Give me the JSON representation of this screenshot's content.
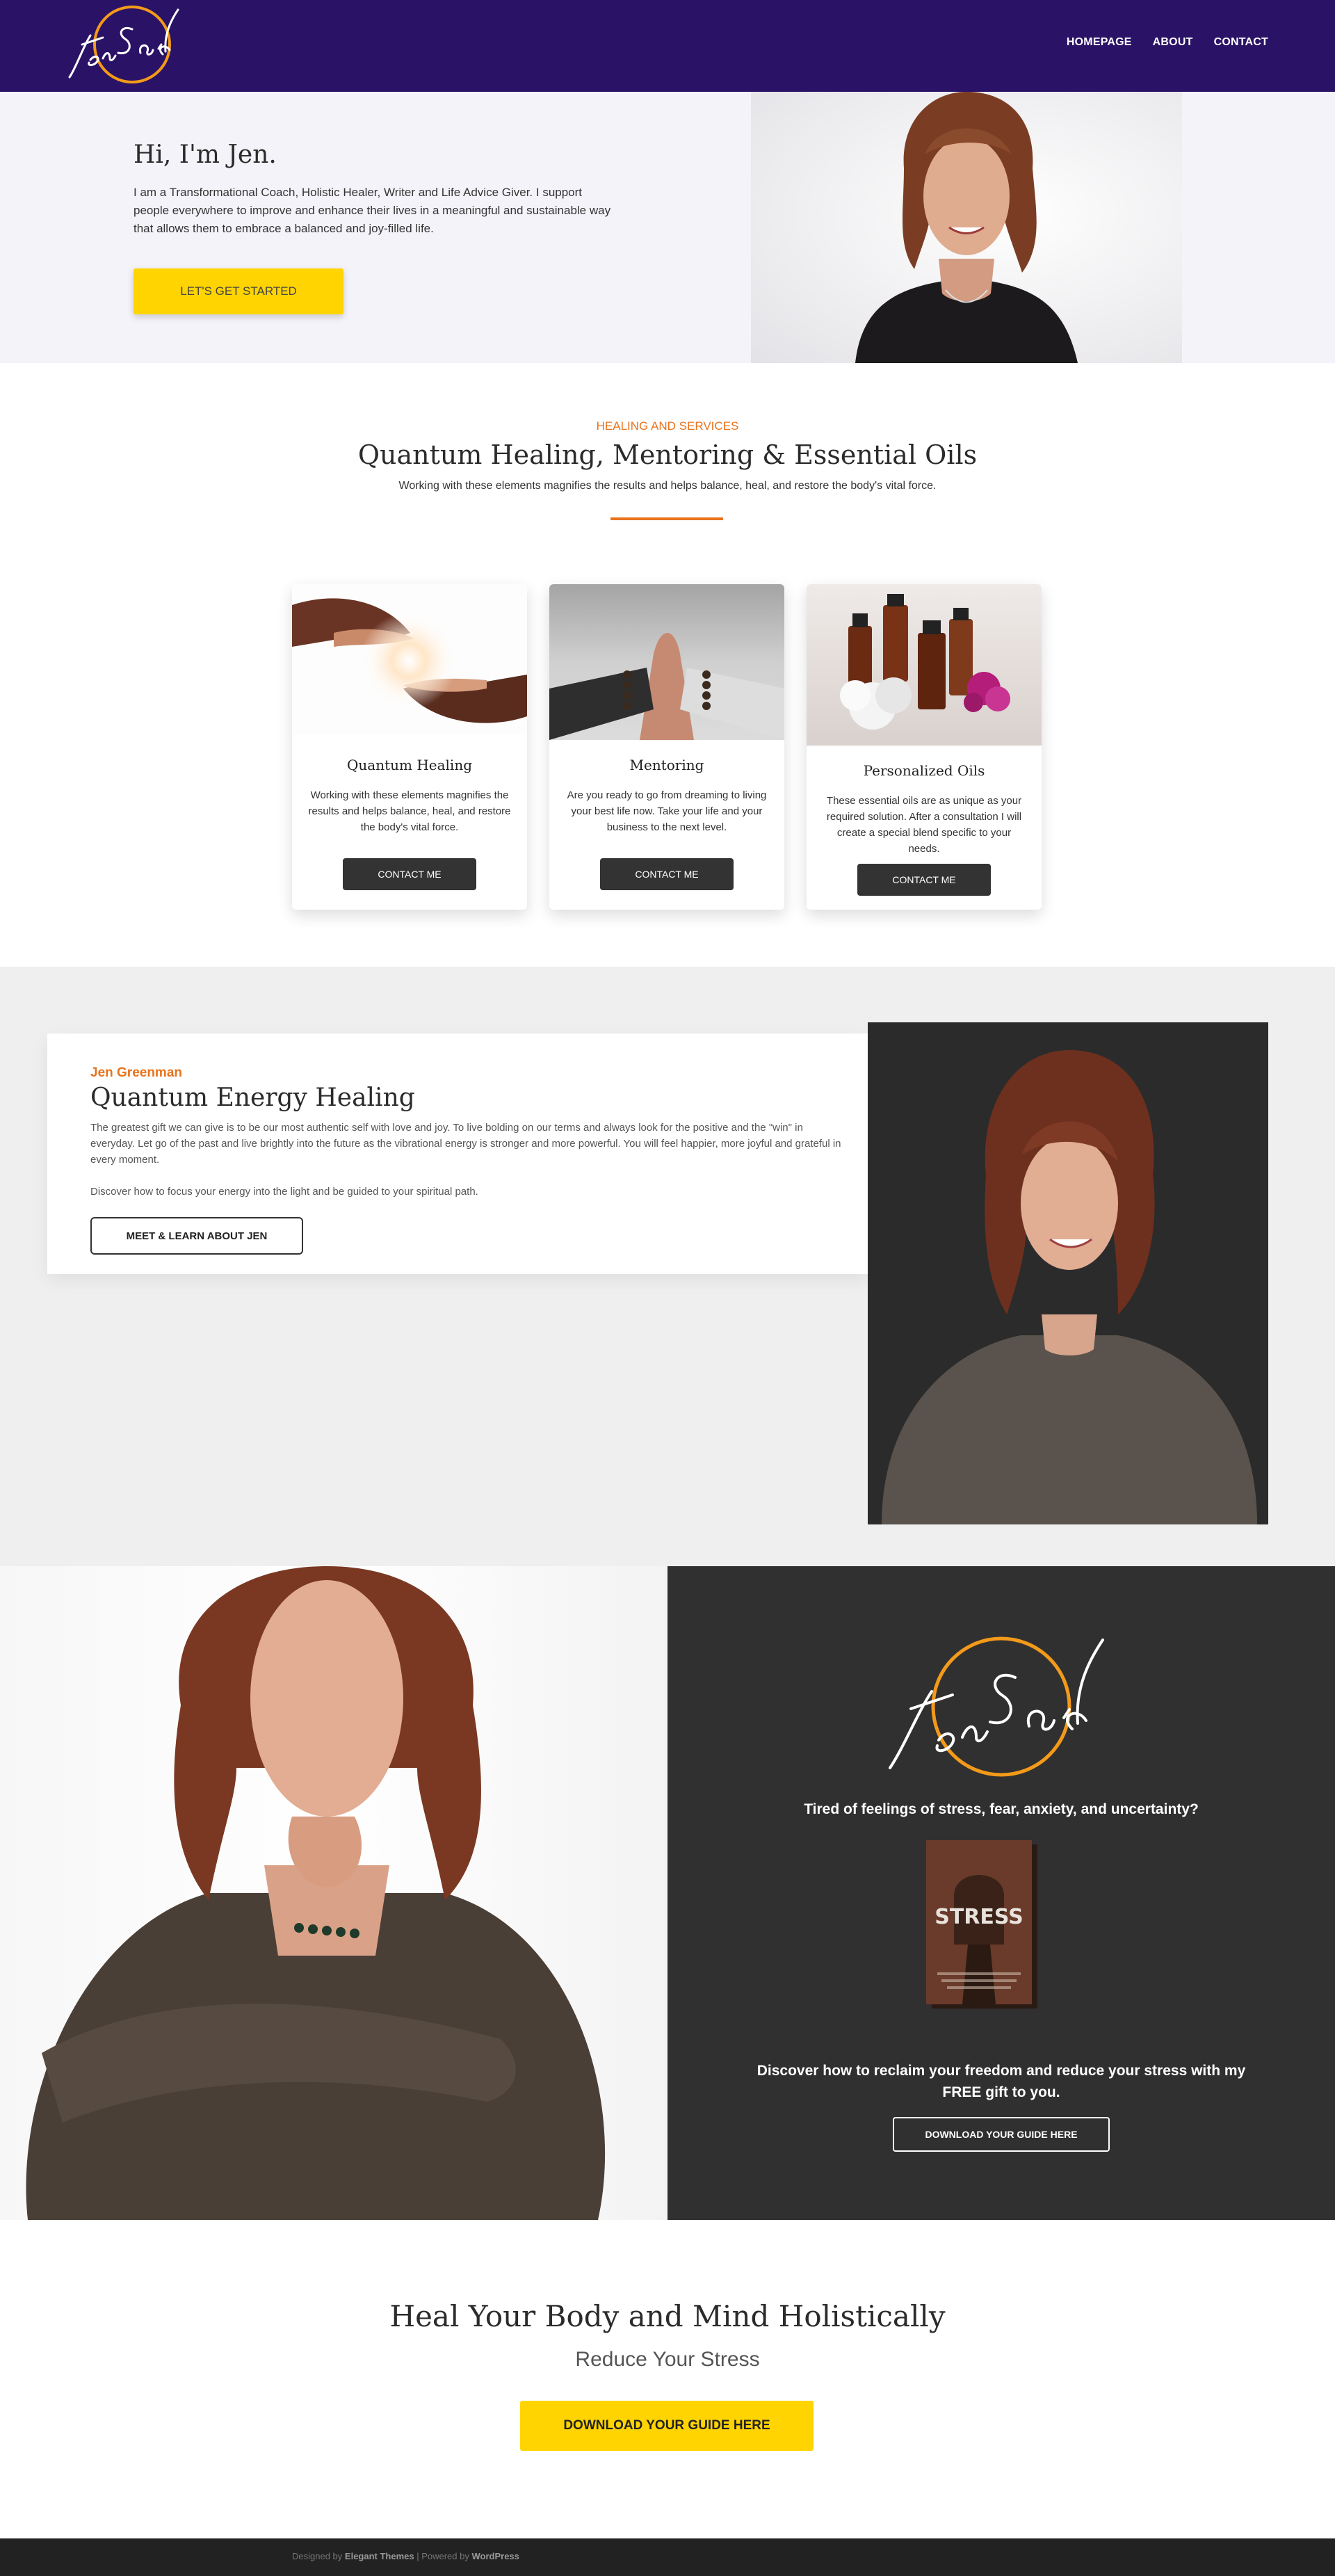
{
  "header": {
    "logo_text": "Jen Said",
    "nav": [
      "HOMEPAGE",
      "ABOUT",
      "CONTACT"
    ]
  },
  "hero": {
    "title": "Hi, I'm Jen.",
    "text": "I am a Transformational Coach, Holistic Healer, Writer and Life Advice Giver. I support people everywhere to improve and enhance their lives in a meaningful and sustainable way that allows them to embrace a balanced and joy-filled life.",
    "button": "LET'S GET STARTED"
  },
  "services": {
    "eyebrow": "HEALING AND SERVICES",
    "title": "Quantum Healing, Mentoring & Essential Oils",
    "subtitle": "Working with these elements magnifies the results and helps balance, heal, and restore the body's vital force.",
    "cards": [
      {
        "title": "Quantum Healing",
        "text": "Working with these elements magnifies the results and helps balance, heal, and restore the body's vital force.",
        "button": "CONTACT ME"
      },
      {
        "title": "Mentoring",
        "text": "Are you ready to go from dreaming to living your best life now. Take your life and your business to the next level.",
        "button": "CONTACT ME"
      },
      {
        "title": "Personalized Oils",
        "text": "These essential oils are as unique as your required solution. After a consultation I will create a special blend specific to your needs.",
        "button": "CONTACT ME"
      }
    ]
  },
  "energy": {
    "name": "Jen Greenman",
    "title": "Quantum Energy Healing",
    "p1": "The greatest gift we can give is to be our most authentic self with love and joy. To live bolding on our terms and always look for the positive and the \"win\" in everyday. Let go of the past and live brightly into the future as the vibrational energy is stronger and more powerful. You will feel happier, more joyful and grateful in every moment.",
    "p2": "Discover how to focus your energy into the light and be guided to your spiritual path.",
    "button": "MEET & LEARN ABOUT JEN"
  },
  "promo": {
    "logo_text": "Jen Said",
    "question": "Tired of feelings of stress, fear, anxiety, and uncertainty?",
    "book_title": "STRESS",
    "description": "Discover how to reclaim your freedom and reduce your stress with my FREE gift to you.",
    "button": "DOWNLOAD YOUR GUIDE HERE"
  },
  "heal": {
    "title": "Heal Your Body and Mind Holistically",
    "subtitle": "Reduce Your Stress",
    "button": "DOWNLOAD YOUR GUIDE HERE"
  },
  "footer": {
    "designed_by": "Designed by",
    "theme": "Elegant Themes",
    "separator": " | Powered by ",
    "cms": "WordPress"
  },
  "colors": {
    "header_bg": "#2a1266",
    "accent_orange": "#e8731c",
    "button_yellow": "#ffd400",
    "dark_panel": "#303030"
  }
}
